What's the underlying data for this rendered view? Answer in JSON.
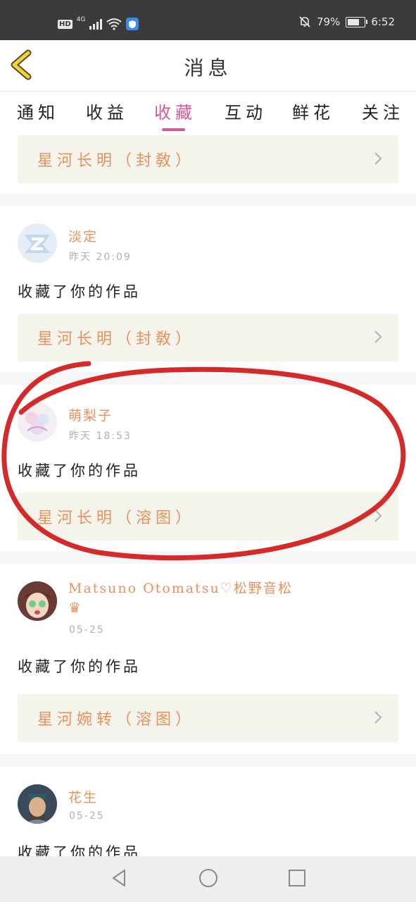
{
  "status_bar": {
    "hd": "HD",
    "network": "4G",
    "battery_text": "79%",
    "battery_level": 0.79,
    "time": "6:52",
    "icons": [
      "hd-icon",
      "signal-icon",
      "wifi-icon",
      "shield-icon",
      "mute-bell-icon",
      "battery-icon"
    ]
  },
  "header": {
    "title": "消息",
    "back_icon": "chevron-left-icon"
  },
  "tabs": [
    {
      "label": "通知",
      "active": false
    },
    {
      "label": "收益",
      "active": false
    },
    {
      "label": "收藏",
      "active": true
    },
    {
      "label": "互动",
      "active": false
    },
    {
      "label": "鲜花",
      "active": false
    },
    {
      "label": "关注",
      "active": false
    }
  ],
  "colors": {
    "accent": "#d4589a",
    "name": "#e8915a",
    "work_bg": "#f4f3ec",
    "annotation": "#d42a2a"
  },
  "top_partial_card": {
    "work_title": "星河长明（封敎）"
  },
  "items": [
    {
      "user": "淡定",
      "time": "昨天 20:09",
      "action": "收藏了你的作品",
      "work_title": "星河长明（封敎）",
      "avatar": "z-logo-avatar"
    },
    {
      "user": "萌梨子",
      "time": "昨天 18:53",
      "action": "收藏了你的作品",
      "work_title": "星河长明（溶图）",
      "avatar": "anime-girl-avatar"
    },
    {
      "user": "Matsuno Otomatsu♡松野音松",
      "badge": "♛",
      "time": "05-25",
      "action": "收藏了你的作品",
      "work_title": "星河婉转（溶图）",
      "avatar": "anime-character-avatar"
    },
    {
      "user": "花生",
      "time": "05-25",
      "action": "收藏了你的作品",
      "avatar": "warrior-avatar"
    }
  ],
  "bottom_nav": {
    "icons": [
      "back-triangle-icon",
      "home-circle-icon",
      "recents-square-icon"
    ]
  }
}
